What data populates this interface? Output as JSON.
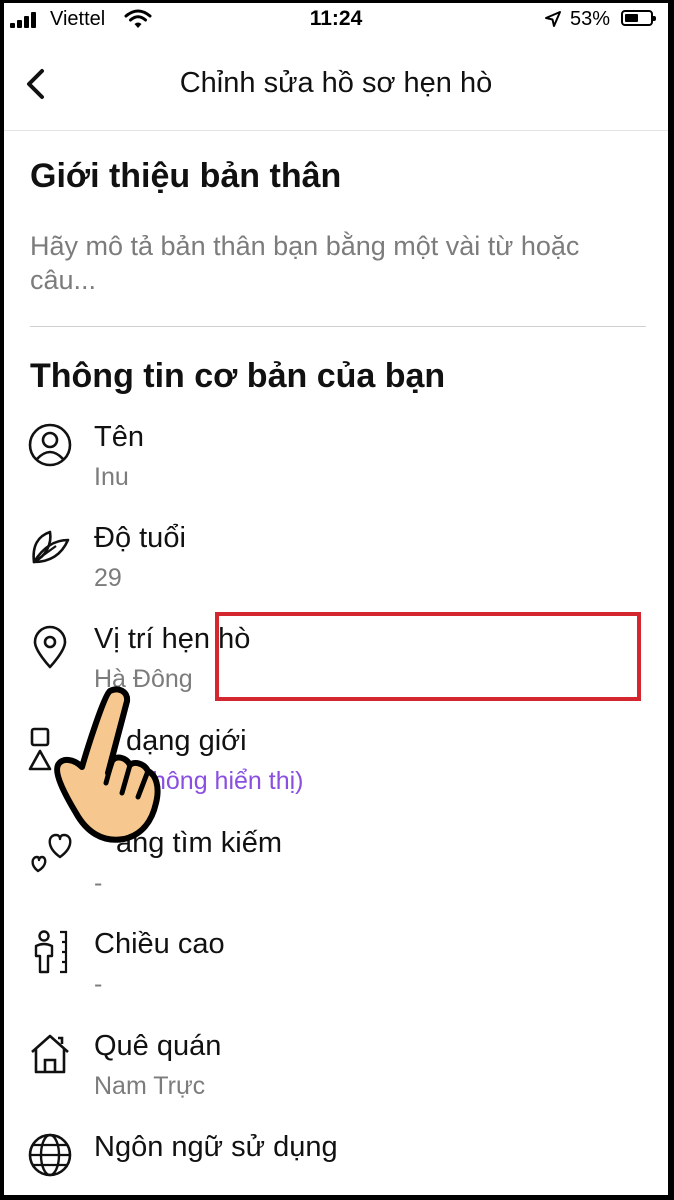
{
  "status_bar": {
    "carrier": "Viettel",
    "time": "11:24",
    "battery_percent": "53%",
    "signal_icon": "cellular-signal-icon",
    "wifi_icon": "wifi-icon",
    "location_icon": "location-arrow-icon",
    "battery_icon": "battery-icon"
  },
  "header": {
    "title": "Chỉnh sửa hồ sơ hẹn hò",
    "back_icon": "chevron-left-icon"
  },
  "bio": {
    "title": "Giới thiệu bản thân",
    "placeholder": "Hãy mô tả bản thân bạn bằng một vài từ hoặc câu..."
  },
  "basic_info": {
    "title": "Thông tin cơ bản của bạn",
    "items": [
      {
        "icon": "person-icon",
        "label": "Tên",
        "value": "Inu"
      },
      {
        "icon": "leaf-icon",
        "label": "Độ tuổi",
        "value": "29"
      },
      {
        "icon": "location-pin-icon",
        "label": "Vị trí hẹn hò",
        "value": "Hà Đông"
      },
      {
        "icon": "shapes-icon",
        "label": "dạng giới",
        "value": "hông hiển thị)"
      },
      {
        "icon": "hearts-icon",
        "label": "ang tìm kiếm",
        "value": "-"
      },
      {
        "icon": "height-icon",
        "label": "Chiều cao",
        "value": "-"
      },
      {
        "icon": "home-icon",
        "label": "Quê quán",
        "value": "Nam Trực"
      },
      {
        "icon": "globe-icon",
        "label": "Ngôn ngữ sử dụng",
        "value": ""
      }
    ]
  },
  "overlay": {
    "highlight_color": "#d4262e",
    "pointer_icon": "pointing-hand-icon"
  }
}
